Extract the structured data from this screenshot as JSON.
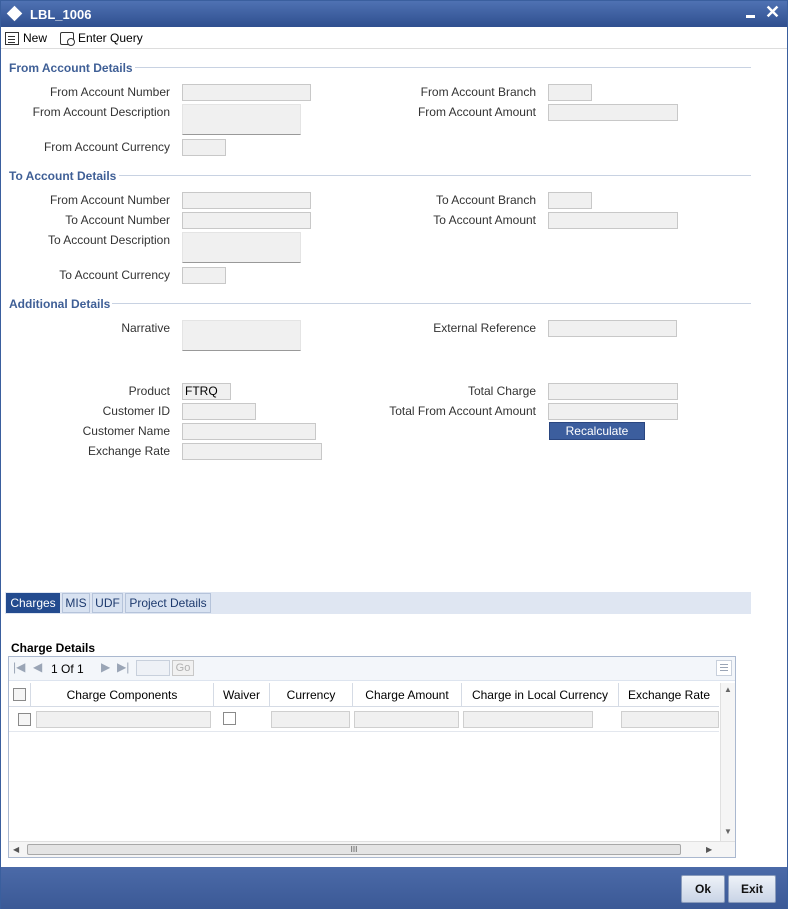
{
  "window": {
    "title": "LBL_1006",
    "minimize_icon": "minimize-icon",
    "close_icon": "close-icon"
  },
  "toolbar": {
    "new_label": "New",
    "enter_query_label": "Enter Query"
  },
  "from_account": {
    "heading": "From Account Details",
    "number_label": "From Account Number",
    "description_label": "From Account Description",
    "currency_label": "From Account Currency",
    "branch_label": "From Account Branch",
    "amount_label": "From Account Amount"
  },
  "to_account": {
    "heading": "To Account Details",
    "from_number_label": "From Account Number",
    "to_number_label": "To Account Number",
    "description_label": "To Account Description",
    "currency_label": "To Account Currency",
    "branch_label": "To Account Branch",
    "amount_label": "To Account Amount"
  },
  "additional": {
    "heading": "Additional Details",
    "narrative_label": "Narrative",
    "external_reference_label": "External Reference",
    "product_label": "Product",
    "product_value": "FTRQ",
    "customer_id_label": "Customer ID",
    "customer_name_label": "Customer Name",
    "exchange_rate_label": "Exchange Rate",
    "total_charge_label": "Total Charge",
    "total_from_amount_label": "Total From Account Amount",
    "recalculate_label": "Recalculate"
  },
  "tabs": [
    {
      "label": "Charges",
      "active": true
    },
    {
      "label": "MIS",
      "active": false
    },
    {
      "label": "UDF",
      "active": false
    },
    {
      "label": "Project Details",
      "active": false
    }
  ],
  "charge_details": {
    "heading": "Charge Details",
    "page_current": "1",
    "page_of": "Of",
    "page_total": "1",
    "go_label": "Go",
    "columns": [
      "Charge Components",
      "Waiver",
      "Currency",
      "Charge Amount",
      "Charge in Local Currency",
      "Exchange Rate"
    ],
    "scroll_thumb_label": "III"
  },
  "footer": {
    "ok_label": "Ok",
    "exit_label": "Exit"
  },
  "colors": {
    "titlebar": "#2f4f8f",
    "section_heading": "#3f5f96",
    "active_tab": "#234b8f",
    "recalculate_button": "#3c5e9e"
  }
}
